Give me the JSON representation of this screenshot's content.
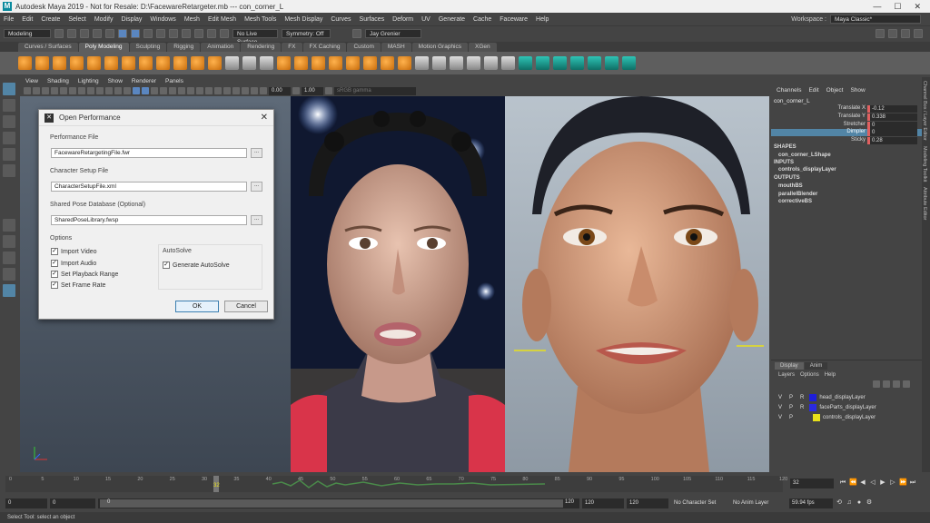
{
  "app": {
    "title": "Autodesk Maya 2019 - Not for Resale: D:\\FacewareRetargeter.mb  ---  con_corner_L",
    "logo": "M",
    "window_controls": [
      "—",
      "☐",
      "✕"
    ]
  },
  "menus": [
    "File",
    "Edit",
    "Create",
    "Select",
    "Modify",
    "Display",
    "Windows",
    "Mesh",
    "Edit Mesh",
    "Mesh Tools",
    "Mesh Display",
    "Curves",
    "Surfaces",
    "Deform",
    "UV",
    "Generate",
    "Cache",
    "Faceware",
    "Help"
  ],
  "workspace": {
    "label": "Workspace :",
    "value": "Maya Classic*"
  },
  "status_line": {
    "mode": "Modeling",
    "live_surface": "No Live Surface",
    "symmetry": "Symmetry: Off",
    "user": "Jay Grenier"
  },
  "shelf_tabs": [
    "Curves / Surfaces",
    "Poly Modeling",
    "Sculpting",
    "Rigging",
    "Animation",
    "Rendering",
    "FX",
    "FX Caching",
    "Custom",
    "MASH",
    "Motion Graphics",
    "XGen"
  ],
  "shelf_active": "Poly Modeling",
  "panel_menu": [
    "View",
    "Shading",
    "Lighting",
    "Show",
    "Renderer",
    "Panels"
  ],
  "panel_fields": {
    "a": "0.00",
    "b": "1.00",
    "color_space": "sRGB gamma"
  },
  "dialog": {
    "title": "Open Performance",
    "performance_label": "Performance File",
    "performance_value": "FacewareRetargetingFile.fwr",
    "character_label": "Character Setup File",
    "character_value": "CharacterSetupFile.xml",
    "pose_label": "Shared Pose Database (Optional)",
    "pose_value": "SharedPoseLibrary.fwsp",
    "browse": "...",
    "options_label": "Options",
    "options": [
      "Import Video",
      "Import Audio",
      "Set Playback Range",
      "Set Frame Rate"
    ],
    "autosolve_label": "AutoSolve",
    "autosolve_option": "Generate AutoSolve",
    "ok": "OK",
    "cancel": "Cancel",
    "close": "✕"
  },
  "channel_box": {
    "menu": [
      "Channels",
      "Edit",
      "Object",
      "Show"
    ],
    "object": "con_corner_L",
    "channels": [
      {
        "name": "Translate X",
        "value": "-0.12"
      },
      {
        "name": "Translate Y",
        "value": "0.338"
      },
      {
        "name": "Stretcher",
        "value": "0"
      },
      {
        "name": "Dimpler",
        "value": "0"
      },
      {
        "name": "Sticky",
        "value": "0.28"
      }
    ],
    "shapes_label": "SHAPES",
    "shapes": [
      "con_corner_LShape"
    ],
    "inputs_label": "INPUTS",
    "inputs": [
      "controls_displayLayer"
    ],
    "outputs_label": "OUTPUTS",
    "outputs": [
      "mouthBS",
      "parallelBlender",
      "correctiveBS"
    ]
  },
  "layer_editor": {
    "tabs": [
      "Display",
      "Anim"
    ],
    "menu": [
      "Layers",
      "Options",
      "Help"
    ],
    "layers": [
      {
        "v": "V",
        "p": "P",
        "r": "R",
        "name": "head_displayLayer",
        "color": "#1e1ed8"
      },
      {
        "v": "V",
        "p": "P",
        "r": "R",
        "name": "faceParts_displayLayer",
        "color": "#2a2ae0"
      },
      {
        "v": "V",
        "p": "P",
        "r": "",
        "name": "controls_displayLayer",
        "color": "#e8e01a"
      }
    ]
  },
  "right_strip_tabs": [
    "Channel Box / Layer Editor",
    "Modeling Toolkit",
    "Attribute Editor"
  ],
  "timeline": {
    "ticks": [
      "0",
      "5",
      "10",
      "15",
      "20",
      "25",
      "30",
      "35",
      "40",
      "45",
      "50",
      "55",
      "60",
      "65",
      "70",
      "75",
      "80",
      "85",
      "90",
      "95",
      "100",
      "105",
      "110",
      "115",
      "120"
    ],
    "current_frame": "32",
    "current_field": "32"
  },
  "range": {
    "start": "0",
    "start2": "0",
    "range_start": "0",
    "range_end": "120",
    "end": "120",
    "end2": "120",
    "char_set": "No Character Set",
    "anim_layer": "No Anim Layer",
    "fps": "59.94 fps"
  },
  "help_line": "Select Tool: select an object"
}
